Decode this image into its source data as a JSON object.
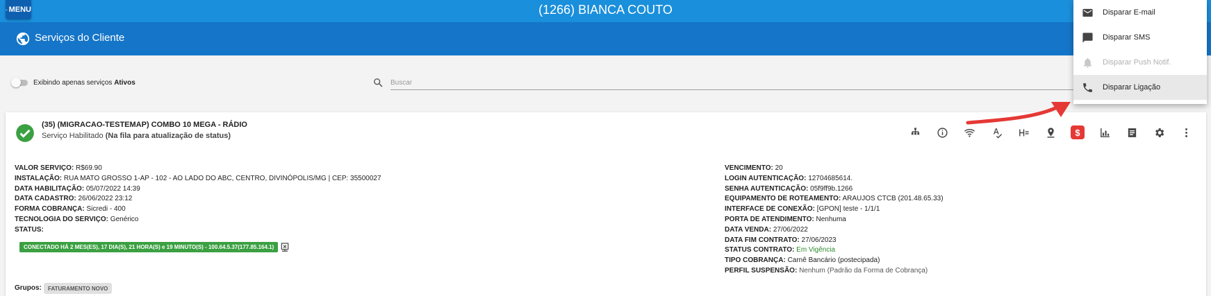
{
  "header": {
    "menu_label": "MENU",
    "client_title": "(1266) BIANCA COUTO"
  },
  "subheader": {
    "title": "Serviços do Cliente",
    "icon": "globe-icon"
  },
  "filter": {
    "toggle_text": "Exibindo apenas serviços",
    "toggle_bold": "Ativos",
    "search_placeholder": "Buscar"
  },
  "service": {
    "title": "(35) (MIGRACAO-TESTEMAP) COMBO 10 MEGA - RÁDIO",
    "status_text": "Serviço Habilitado",
    "status_note": "(Na fila para atualização de status)",
    "toolbar_icons": [
      "sitemap-icon",
      "info-icon",
      "wifi-icon",
      "spellcheck-icon",
      "heading-icon",
      "location-pin-icon",
      "dollar-icon",
      "chart-icon",
      "document-icon",
      "gear-icon",
      "more-vert-icon"
    ],
    "left_fields": [
      {
        "label": "VALOR SERVIÇO:",
        "value": "R$69.90"
      },
      {
        "label": "INSTALAÇÃO:",
        "value": "RUA MATO GROSSO 1-AP - 102 - AO LADO DO ABC, CENTRO, DIVINÓPOLIS/MG | CEP: 35500027"
      },
      {
        "label": "DATA HABILITAÇÃO:",
        "value": "05/07/2022 14:39"
      },
      {
        "label": "DATA CADASTRO:",
        "value": "26/06/2022 23:12"
      },
      {
        "label": "FORMA COBRANÇA:",
        "value": "Sicredi - 400"
      },
      {
        "label": "TECNOLOGIA DO SERVIÇO:",
        "value": "Genérico"
      },
      {
        "label": "STATUS:",
        "value": ""
      }
    ],
    "connection_badge": "CONECTADO HÁ 2 MES(ES), 17 DIA(S), 21 HORA(S) e 19 MINUTO(S) - 100.64.5.37(177.85.164.1)",
    "right_fields": [
      {
        "label": "VENCIMENTO:",
        "value": "20"
      },
      {
        "label": "LOGIN AUTENTICAÇÃO:",
        "value": "12704685614."
      },
      {
        "label": "SENHA AUTENTICAÇÃO:",
        "value": "05f9ff9b.1266"
      },
      {
        "label": "EQUIPAMENTO DE ROTEAMENTO:",
        "value": "ARAUJOS CTCB (201.48.65.33)"
      },
      {
        "label": "INTERFACE DE CONEXÃO:",
        "value": "[GPON] teste - 1/1/1"
      },
      {
        "label": "PORTA DE ATENDIMENTO:",
        "value": "Nenhuma"
      },
      {
        "label": "DATA VENDA:",
        "value": "27/06/2022"
      },
      {
        "label": "DATA FIM CONTRATO:",
        "value": "27/06/2023"
      },
      {
        "label": "STATUS CONTRATO:",
        "value": "Em Vigência"
      },
      {
        "label": "TIPO COBRANÇA:",
        "value": "Carnê Bancário (postecipada)"
      },
      {
        "label": "PERFIL SUSPENSÃO:",
        "value": "Nenhum (Padrão da Forma de Cobrança)"
      }
    ],
    "groups_label": "Grupos:",
    "group_chip": "FATURAMENTO NOVO"
  },
  "dropdown": {
    "items": [
      {
        "label": "Disparar E-mail",
        "icon": "email-icon"
      },
      {
        "label": "Disparar SMS",
        "icon": "sms-icon"
      },
      {
        "label": "Disparar Push Notif.",
        "icon": "bell-icon"
      },
      {
        "label": "Disparar Ligação",
        "icon": "phone-icon"
      }
    ]
  },
  "colors": {
    "topbar": "#1a8fdb",
    "subbar": "#1575c8",
    "accent_green": "#3aa041",
    "dollar_red": "#e53935",
    "arrow_red": "#e53935"
  }
}
